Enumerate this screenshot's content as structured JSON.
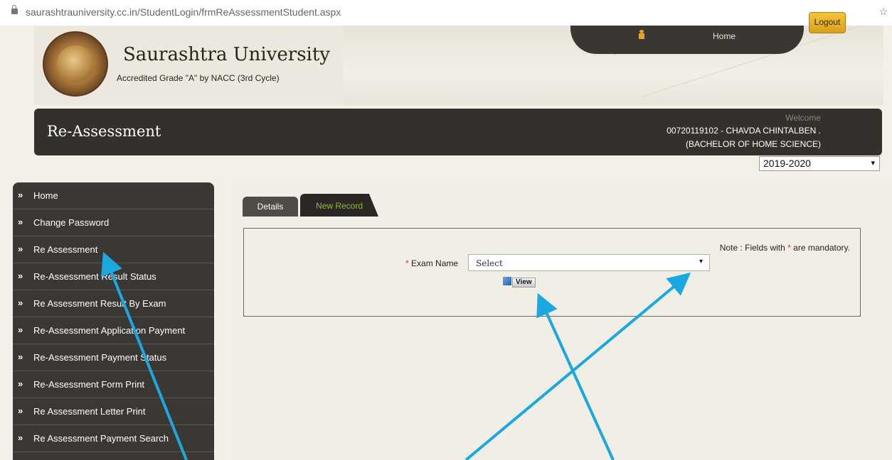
{
  "browser": {
    "url": "saurashtrauniversity.cc.in/StudentLogin/frmReAssessmentStudent.aspx",
    "star_glyph": "☆"
  },
  "header": {
    "university_name": "Saurashtra University",
    "accreditation": "Accredited Grade \"A\" by NACC (3rd Cycle)",
    "home_link": "Home",
    "logo_text_outer_top": "",
    "colors": {
      "bar": "#34302c",
      "accent_tab_text": "#8fbf2a",
      "logout": "#e3ae2a"
    }
  },
  "titlebar": {
    "title": "Re-Assessment",
    "welcome": "Welcome",
    "user_line1": "00720119102 - CHAVDA CHINTALBEN .",
    "user_line2": "(BACHELOR OF HOME SCIENCE)",
    "logout_label": "Logout"
  },
  "year_select": {
    "value": "2019-2020",
    "arrow": "▾"
  },
  "sidebar": {
    "chevron": "»",
    "items": [
      {
        "label": "Home"
      },
      {
        "label": "Change Password"
      },
      {
        "label": "Re Assessment"
      },
      {
        "label": "Re-Assessment Result Status"
      },
      {
        "label": "Re Assessment Result By Exam"
      },
      {
        "label": "Re-Assessment Application Payment"
      },
      {
        "label": "Re-Assessment Payment Status"
      },
      {
        "label": "Re-Assessment Form Print"
      },
      {
        "label": "Re Assessment Letter Print"
      },
      {
        "label": "Re Assessment Payment Search"
      }
    ]
  },
  "tabs": {
    "details": "Details",
    "new_record": "New Record"
  },
  "form": {
    "note_prefix": "Note : Fields with",
    "required_mark": "*",
    "note_suffix": "are mandatory.",
    "exam_label": "Exam Name",
    "exam_value": "Select",
    "exam_arrow": "▾",
    "view_button": "View"
  },
  "annotations": {
    "arrow_color": "#1aa8e0"
  }
}
